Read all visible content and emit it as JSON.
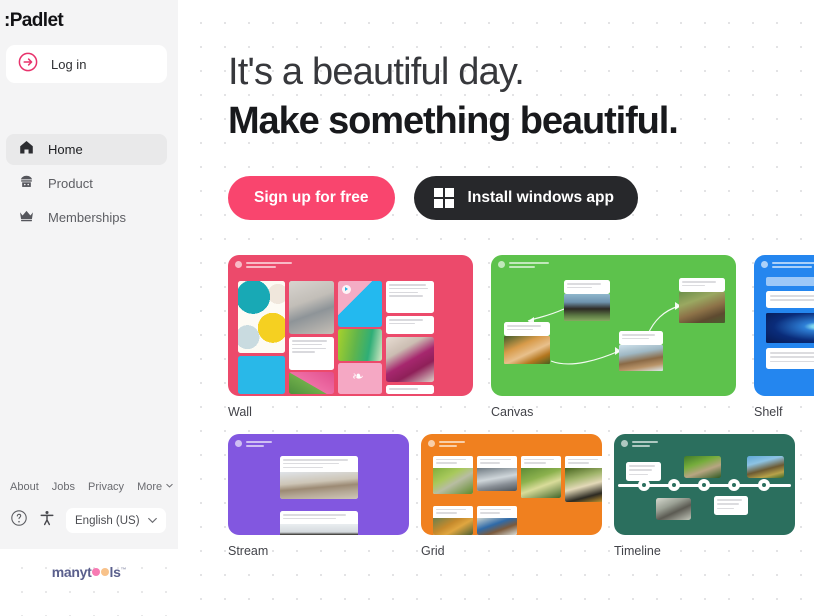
{
  "brand": {
    "name": ":Padlet"
  },
  "sidebar": {
    "login": {
      "label": "Log in",
      "icon": "arrow-right-circle-icon",
      "accent": "#e8336c"
    },
    "nav": [
      {
        "label": "Home",
        "icon": "home-icon",
        "active": true
      },
      {
        "label": "Product",
        "icon": "product-dome-icon",
        "active": false
      },
      {
        "label": "Memberships",
        "icon": "crown-icon",
        "active": false
      }
    ],
    "footer_links": [
      {
        "label": "About"
      },
      {
        "label": "Jobs"
      },
      {
        "label": "Privacy"
      },
      {
        "label": "More",
        "icon": "chevron-down-icon"
      }
    ],
    "help_icon": "question-circle-icon",
    "accessibility_icon": "accessibility-icon",
    "language": {
      "value": "English (US)",
      "icon": "caret-down-icon"
    },
    "watermark": {
      "prefix": "manyt",
      "suffix": "ls",
      "tm": "™",
      "dot1_color": "#f77ab2",
      "dot2_color": "#f8c28a",
      "text_color": "#5a5f8c"
    }
  },
  "hero": {
    "line1": "It's a beautiful day.",
    "line2": "Make something beautiful."
  },
  "cta": {
    "signup": {
      "label": "Sign up for free",
      "color": "#f9456e"
    },
    "install": {
      "label": "Install windows app",
      "icon": "windows-logo-icon",
      "color": "#27282b"
    }
  },
  "gallery": {
    "row1": [
      {
        "label": "Wall",
        "color": "#ec4a6b"
      },
      {
        "label": "Canvas",
        "color": "#5dc24c"
      },
      {
        "label": "Shelf",
        "color": "#2486ef"
      }
    ],
    "row2": [
      {
        "label": "Stream",
        "color": "#8257e0"
      },
      {
        "label": "Grid",
        "color": "#f0801f"
      },
      {
        "label": "Timeline",
        "color": "#2b6f5e"
      }
    ]
  },
  "background": {
    "page": "#ffffff",
    "sidebar": "#f4f4f5",
    "dot": "#e3e3e5",
    "dot_spacing_px": 24
  }
}
